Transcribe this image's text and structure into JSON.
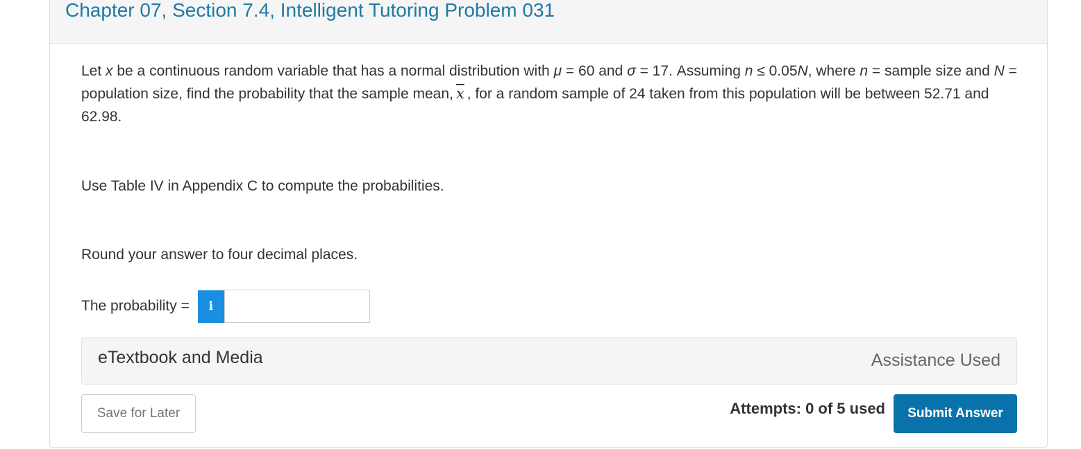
{
  "header": {
    "title": "Chapter 07, Section 7.4, Intelligent Tutoring Problem 031"
  },
  "question": {
    "p1": "Let ",
    "var_x": "x",
    "p2": " be a continuous random variable that has a normal distribution with ",
    "mu": "μ",
    "p3": " = 60 and ",
    "sigma": "σ",
    "p4": " = 17. Assuming ",
    "var_n1": "n",
    "p5": " ≤ 0.05",
    "var_N1": "N",
    "p6": ", where ",
    "var_n2": "n",
    "p7": " = sample size and ",
    "var_N2": "N",
    "p8": " = population size, find the probability that the sample mean,",
    "xbar": "x",
    "p9": ", for a random sample of 24 taken from this population will be between 52.71 and 62.98."
  },
  "instructions": {
    "table_note": "Use Table IV in Appendix C to compute the probabilities.",
    "rounding": "Round your answer to four decimal places."
  },
  "answer": {
    "label": "The probability =",
    "info_icon": "i",
    "value": ""
  },
  "media": {
    "title": "eTextbook and Media",
    "assistance": "Assistance Used"
  },
  "footer": {
    "save_label": "Save for Later",
    "attempts": "Attempts: 0 of 5 used",
    "submit_label": "Submit Answer"
  },
  "colors": {
    "title": "#1f7aa3",
    "info_button": "#1a8ee0",
    "submit_button": "#0a72ab"
  },
  "icons": {
    "info": "info-icon"
  }
}
